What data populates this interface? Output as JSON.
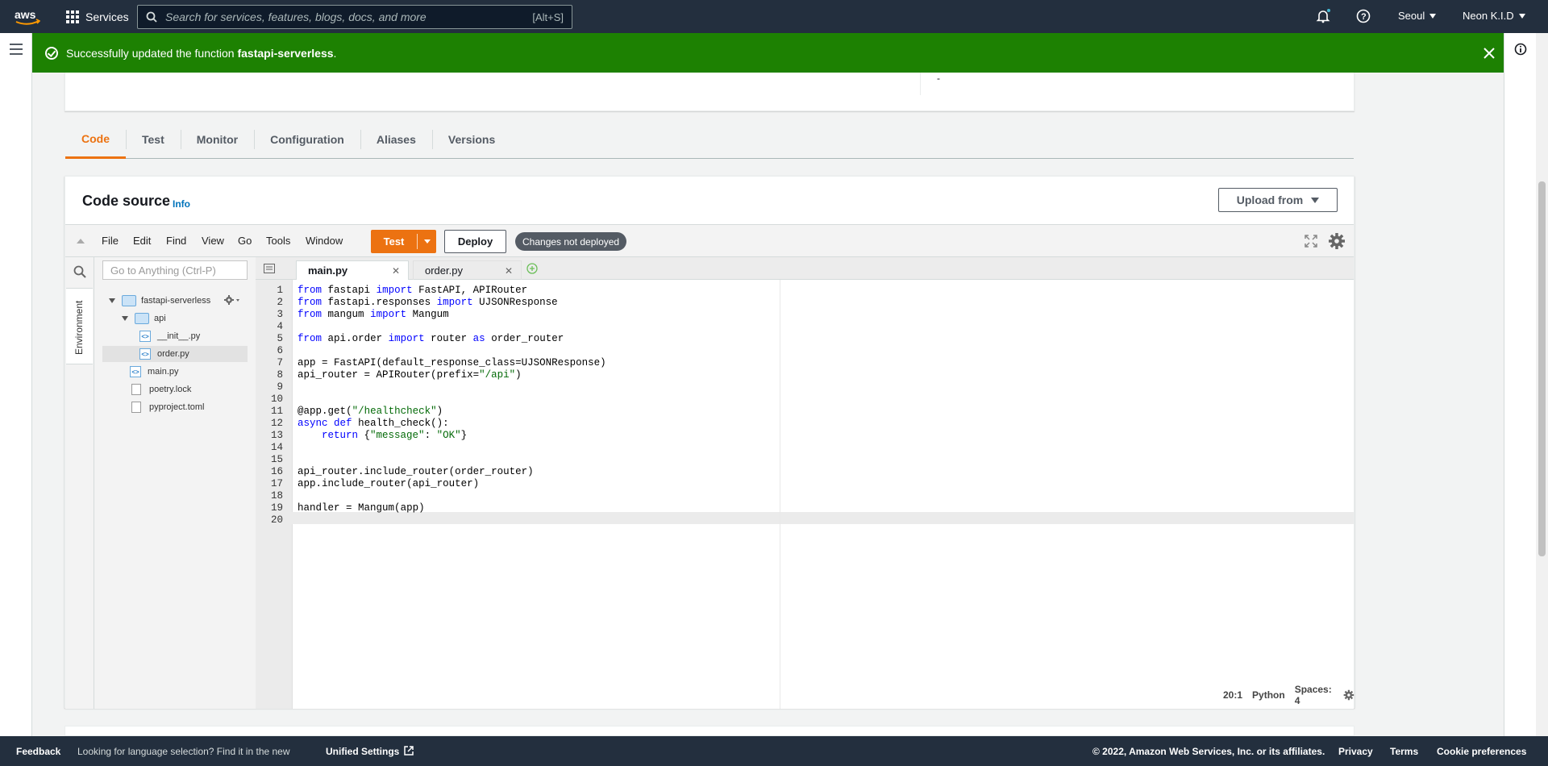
{
  "topnav": {
    "services_label": "Services",
    "search_placeholder": "Search for services, features, blogs, docs, and more",
    "search_shortcut": "[Alt+S]",
    "region": "Seoul",
    "account": "Neon K.I.D"
  },
  "flash": {
    "message_prefix": "Successfully updated the function ",
    "function_name": "fastapi-serverless",
    "message_suffix": "."
  },
  "top_panel": {
    "value": "-"
  },
  "tabs": [
    {
      "label": "Code",
      "active": true
    },
    {
      "label": "Test"
    },
    {
      "label": "Monitor"
    },
    {
      "label": "Configuration"
    },
    {
      "label": "Aliases"
    },
    {
      "label": "Versions"
    }
  ],
  "code_source": {
    "title": "Code source",
    "info": "Info",
    "upload_label": "Upload from",
    "menu": [
      "File",
      "Edit",
      "Find",
      "View",
      "Go",
      "Tools",
      "Window"
    ],
    "test_label": "Test",
    "deploy_label": "Deploy",
    "changes_badge": "Changes not deployed",
    "goto_placeholder": "Go to Anything (Ctrl-P)",
    "environment_label": "Environment",
    "tree": {
      "root": "fastapi-serverless",
      "api_folder": "api",
      "init_file": "__init__.py",
      "order_file": "order.py",
      "main_file": "main.py",
      "poetry_lock": "poetry.lock",
      "pyproject": "pyproject.toml"
    },
    "editor_tabs": [
      "main.py",
      "order.py"
    ],
    "code_lines": [
      "from fastapi import FastAPI, APIRouter",
      "from fastapi.responses import UJSONResponse",
      "from mangum import Mangum",
      "",
      "from api.order import router as order_router",
      "",
      "app = FastAPI(default_response_class=UJSONResponse)",
      "api_router = APIRouter(prefix=\"/api\")",
      "",
      "",
      "@app.get(\"/healthcheck\")",
      "async def health_check():",
      "    return {\"message\": \"OK\"}",
      "",
      "",
      "api_router.include_router(order_router)",
      "app.include_router(api_router)",
      "",
      "handler = Mangum(app)",
      ""
    ],
    "status": {
      "cursor": "20:1",
      "language": "Python",
      "spaces": "Spaces: 4"
    }
  },
  "footer": {
    "feedback": "Feedback",
    "language_note": "Looking for language selection? Find it in the new",
    "unified_settings": "Unified Settings",
    "copyright": "© 2022, Amazon Web Services, Inc. or its affiliates.",
    "privacy": "Privacy",
    "terms": "Terms",
    "cookie": "Cookie preferences"
  },
  "colors": {
    "nav_bg": "#232f3e",
    "success_green": "#1d8102",
    "accent_orange": "#ec7211",
    "link_blue": "#0073bb"
  }
}
